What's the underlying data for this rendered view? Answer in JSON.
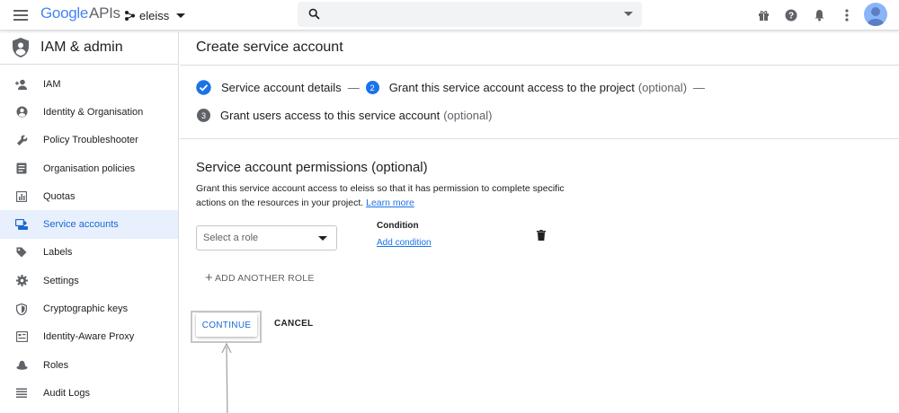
{
  "topbar": {
    "logo_google": "Google",
    "logo_apis": "APIs",
    "project_name": "eleiss",
    "search_value": "",
    "icons": [
      "menu-icon",
      "gift-icon",
      "help-icon",
      "bell-icon",
      "more-vert-icon",
      "avatar"
    ]
  },
  "sidebar": {
    "title": "IAM & admin",
    "items": [
      {
        "label": "IAM",
        "icon": "person-add-icon"
      },
      {
        "label": "Identity & Organisation",
        "icon": "account-circle-icon"
      },
      {
        "label": "Policy Troubleshooter",
        "icon": "wrench-icon"
      },
      {
        "label": "Organisation policies",
        "icon": "document-icon"
      },
      {
        "label": "Quotas",
        "icon": "chart-icon"
      },
      {
        "label": "Service accounts",
        "icon": "service-account-icon",
        "active": true
      },
      {
        "label": "Labels",
        "icon": "tag-icon"
      },
      {
        "label": "Settings",
        "icon": "gear-icon"
      },
      {
        "label": "Cryptographic keys",
        "icon": "security-shield-icon"
      },
      {
        "label": "Identity-Aware Proxy",
        "icon": "proxy-icon"
      },
      {
        "label": "Roles",
        "icon": "hat-icon"
      },
      {
        "label": "Audit Logs",
        "icon": "list-icon"
      }
    ]
  },
  "main": {
    "page_title": "Create service account",
    "steps": {
      "step1_label": "Service account details",
      "sep": "—",
      "step2_num": "2",
      "step2_label": "Grant this service account access to the project",
      "step2_opt": "(optional)",
      "step3_num": "3",
      "step3_label": "Grant users access to this service account",
      "step3_opt": "(optional)"
    },
    "section_title": "Service account permissions (optional)",
    "desc_text": "Grant this service account access to eleiss so that it has permission to complete specific actions on the resources in your project.",
    "learn_more": "Learn more",
    "role_select_placeholder": "Select a role",
    "condition_label": "Condition",
    "add_condition": "Add condition",
    "add_another_role": "ADD ANOTHER ROLE",
    "continue_label": "CONTINUE",
    "cancel_label": "CANCEL"
  },
  "colors": {
    "accent": "#1a73e8",
    "active_bg": "#e8f0fe",
    "step_done": "#1a73e8",
    "step_current": "#1a73e8",
    "step_pending": "#5f6368"
  }
}
